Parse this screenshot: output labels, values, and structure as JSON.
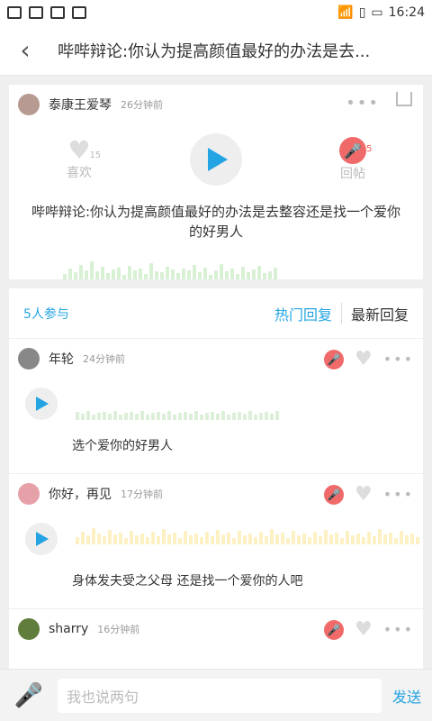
{
  "status": {
    "time": "16:24"
  },
  "header": {
    "title": "哔哔辩论:你认为提高颜值最好的办法是去..."
  },
  "post": {
    "user": "泰康王爱琴",
    "time": "26分钟前",
    "like_label": "喜欢",
    "like_count": "15",
    "reply_label": "回帖",
    "reply_count": "5",
    "question": "哔哔辩论:你认为提高颜值最好的办法是去整容还是找一个爱你的好男人"
  },
  "participants": {
    "count": "5人参与",
    "tab_hot": "热门回复",
    "tab_new": "最新回复"
  },
  "replies": [
    {
      "user": "年轮",
      "time": "24分钟前",
      "text": "选个爱你的好男人",
      "avatar_color": "#888"
    },
    {
      "user": "你好，再见",
      "time": "17分钟前",
      "text": "身体发夫受之父母 还是找一个爱你的人吧",
      "avatar_color": "#e6a0a8"
    },
    {
      "user": "sharry",
      "time": "16分钟前",
      "text": "",
      "avatar_color": "#607d3b"
    }
  ],
  "input": {
    "placeholder": "我也说两句",
    "send": "发送"
  }
}
